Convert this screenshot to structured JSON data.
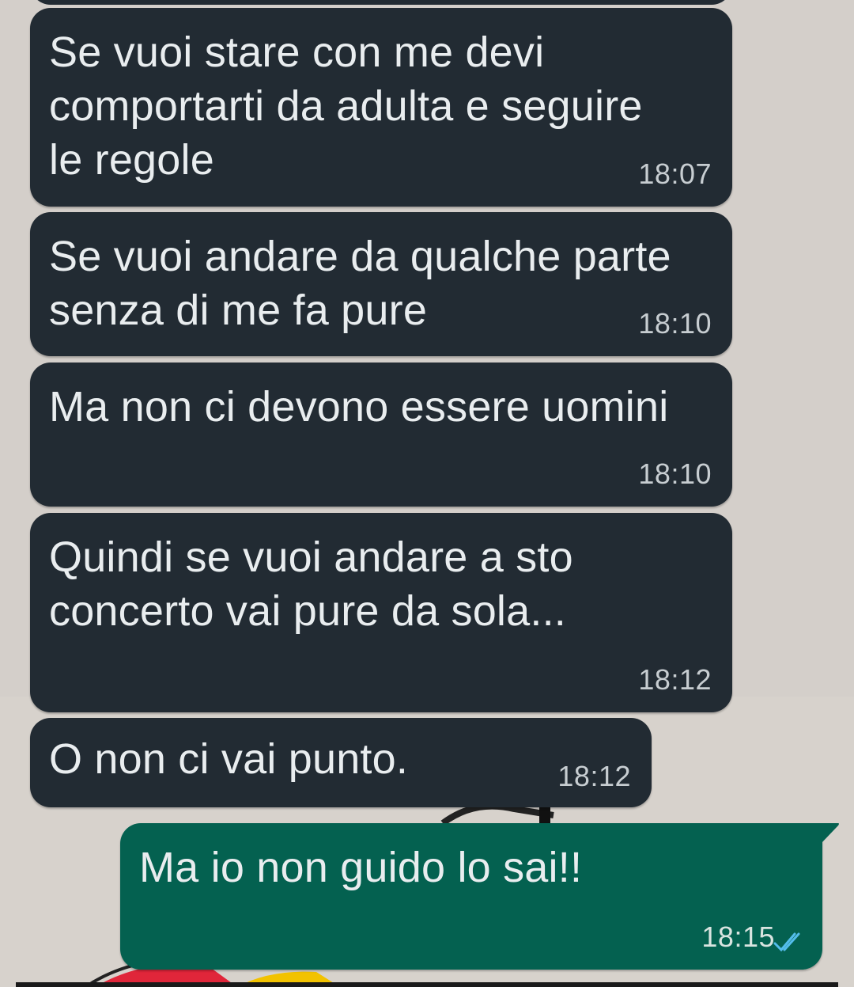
{
  "messages": [
    {
      "direction": "incoming",
      "text": "Se vuoi stare con me devi\ncomportarti da adulta e seguire\nle regole",
      "time": "18:07"
    },
    {
      "direction": "incoming",
      "text": "Se vuoi andare da qualche parte\nsenza di me fa pure",
      "time": "18:10"
    },
    {
      "direction": "incoming",
      "text": "Ma non ci devono essere uomini",
      "time": "18:10"
    },
    {
      "direction": "incoming",
      "text": "Quindi se vuoi andare a sto\nconcerto vai pure da sola...",
      "time": "18:12"
    },
    {
      "direction": "incoming",
      "text": "O non ci vai punto.",
      "time": "18:12"
    },
    {
      "direction": "outgoing",
      "text": "Ma io non guido lo sai!!",
      "time": "18:15",
      "status": "read",
      "status_icon": "double-check-icon",
      "status_color": "#53bdeb"
    }
  ],
  "colors": {
    "incoming_bubble": "#222b33",
    "outgoing_bubble": "#046150",
    "chat_background": "#d7d2cc"
  }
}
